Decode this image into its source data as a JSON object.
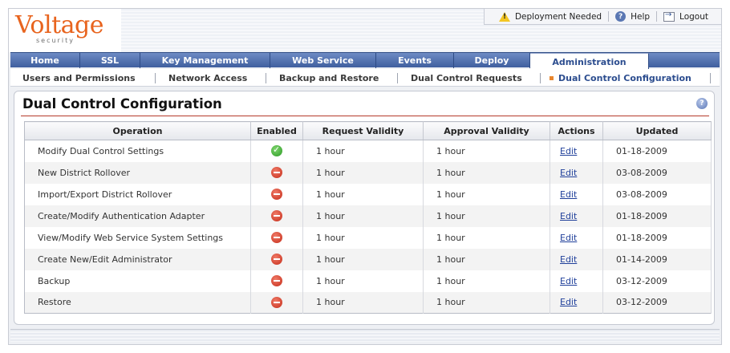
{
  "brand": {
    "name": "Voltage",
    "tagline": "security"
  },
  "utility": {
    "deployment": "Deployment Needed",
    "help": "Help",
    "logout": "Logout"
  },
  "main_tabs": [
    {
      "label": "Home"
    },
    {
      "label": "SSL"
    },
    {
      "label": "Key Management"
    },
    {
      "label": "Web Service"
    },
    {
      "label": "Events"
    },
    {
      "label": "Deploy"
    },
    {
      "label": "Administration",
      "active": true
    }
  ],
  "sub_tabs": [
    {
      "label": "Users and Permissions"
    },
    {
      "label": "Network Access"
    },
    {
      "label": "Backup and Restore"
    },
    {
      "label": "Dual Control Requests"
    },
    {
      "label": "Dual Control Configuration",
      "active": true
    }
  ],
  "page": {
    "title": "Dual Control Configuration"
  },
  "table": {
    "columns": [
      "Operation",
      "Enabled",
      "Request Validity",
      "Approval Validity",
      "Actions",
      "Updated"
    ],
    "rows": [
      {
        "operation": "Modify Dual Control Settings",
        "enabled": true,
        "request": "1 hour",
        "approval": "1 hour",
        "action": "Edit",
        "updated": "01-18-2009"
      },
      {
        "operation": "New District Rollover",
        "enabled": false,
        "request": "1 hour",
        "approval": "1 hour",
        "action": "Edit",
        "updated": "03-08-2009"
      },
      {
        "operation": "Import/Export District Rollover",
        "enabled": false,
        "request": "1 hour",
        "approval": "1 hour",
        "action": "Edit",
        "updated": "03-08-2009"
      },
      {
        "operation": "Create/Modify Authentication Adapter",
        "enabled": false,
        "request": "1 hour",
        "approval": "1 hour",
        "action": "Edit",
        "updated": "01-18-2009"
      },
      {
        "operation": "View/Modify Web Service System Settings",
        "enabled": false,
        "request": "1 hour",
        "approval": "1 hour",
        "action": "Edit",
        "updated": "01-18-2009"
      },
      {
        "operation": "Create New/Edit Administrator",
        "enabled": false,
        "request": "1 hour",
        "approval": "1 hour",
        "action": "Edit",
        "updated": "01-14-2009"
      },
      {
        "operation": "Backup",
        "enabled": false,
        "request": "1 hour",
        "approval": "1 hour",
        "action": "Edit",
        "updated": "03-12-2009"
      },
      {
        "operation": "Restore",
        "enabled": false,
        "request": "1 hour",
        "approval": "1 hour",
        "action": "Edit",
        "updated": "03-12-2009"
      }
    ]
  },
  "colors": {
    "accent": "#e8641e",
    "nav": "#3f5f9f",
    "enabled": "#2c9a26",
    "disabled": "#c52d1a"
  }
}
